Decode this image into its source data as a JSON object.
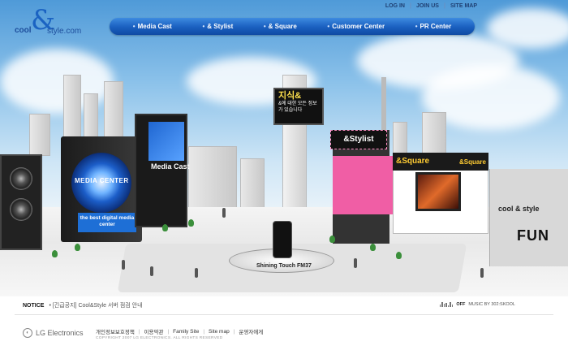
{
  "header": {
    "logo": {
      "cool": "cool",
      "amp": "&",
      "style": "style.com"
    },
    "util_nav": [
      "LOG IN",
      "JOIN US",
      "SITE MAP"
    ],
    "gnb": [
      "Media Cast",
      "& Stylist",
      "& Square",
      "Customer Center",
      "PR Center"
    ]
  },
  "scene": {
    "media_center_label": "MEDIA CENTER",
    "media_center_side": "MEDIA CENTER",
    "media_center_sign": "the best digital media center",
    "media_cast_label": "Media Cast",
    "billboard_big": "지식&",
    "billboard_text": "&에 대한 모든 정보가 있습니다",
    "stylist_sign": "&Stylist",
    "square_sign": "&Square",
    "square_sign_2": "&Square",
    "stage_label": "Shining Touch FM37",
    "fun_logo": "cool & style",
    "fun_text": "FUN",
    "wall_url": "cool&style.com"
  },
  "notice": {
    "label": "NOTICE",
    "text": "• [긴급공지] Cool&Style 서버 점검 안내"
  },
  "music": {
    "state": "OFF",
    "credit": "MUSIC BY 302:SKOOL"
  },
  "footer": {
    "company": "LG Electronics",
    "links": [
      "개인정보보호정책",
      "이용약관",
      "Family Site",
      "Site map",
      "운영자에게"
    ],
    "copyright": "COPYRIGHT 2007 LG ELECTRONICS. ALL RIGHTS RESERVED"
  }
}
